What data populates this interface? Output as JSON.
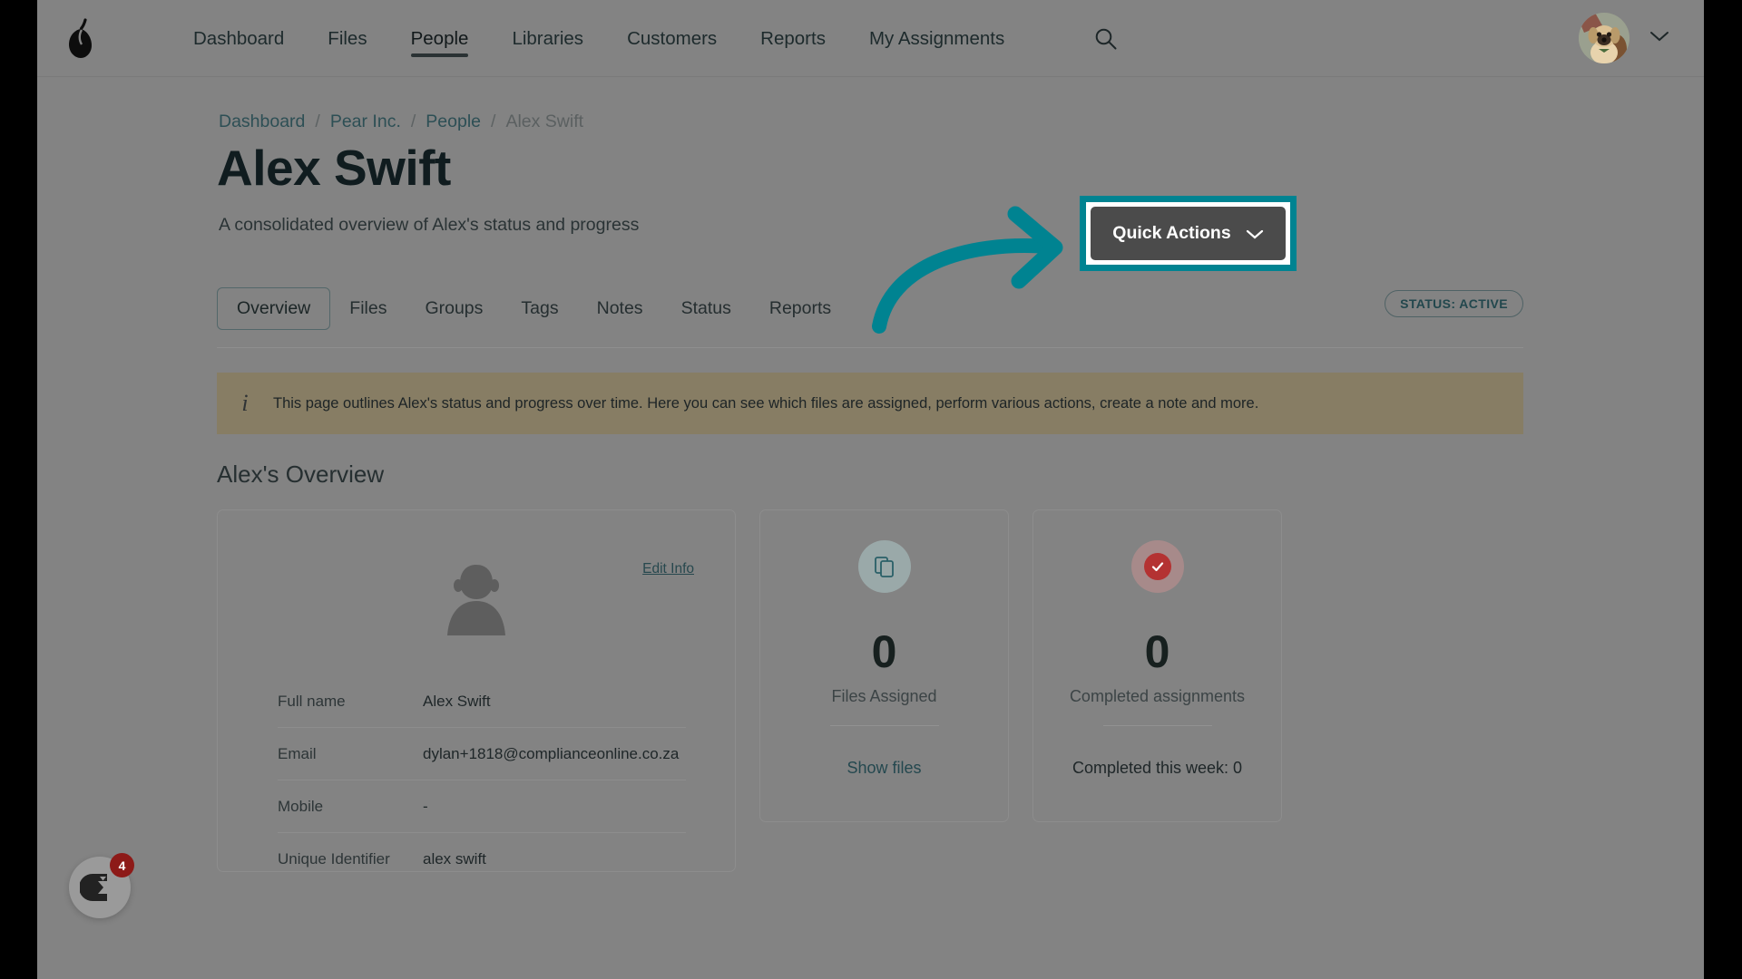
{
  "nav": {
    "brand_icon": "pear-logo-icon",
    "links": [
      {
        "label": "Dashboard",
        "active": false
      },
      {
        "label": "Files",
        "active": false
      },
      {
        "label": "People",
        "active": true
      },
      {
        "label": "Libraries",
        "active": false
      },
      {
        "label": "Customers",
        "active": false
      },
      {
        "label": "Reports",
        "active": false
      },
      {
        "label": "My Assignments",
        "active": false
      }
    ],
    "search_icon": "search-icon",
    "avatar_alt": "user-avatar-dog-photo",
    "chevron_icon": "chevron-down-icon"
  },
  "breadcrumb": {
    "items": [
      {
        "label": "Dashboard",
        "current": false
      },
      {
        "label": "Pear Inc.",
        "current": false
      },
      {
        "label": "People",
        "current": false
      },
      {
        "label": "Alex Swift",
        "current": true
      }
    ],
    "separator": "/"
  },
  "header": {
    "title": "Alex Swift",
    "subtitle": "A consolidated overview of Alex's status and progress",
    "quick_actions_label": "Quick Actions",
    "quick_actions_chevron": "chevron-down-icon"
  },
  "annotation": {
    "arrow_color": "#008391",
    "highlight_border_color": "#008391",
    "highlight_inner_color": "#ffffff"
  },
  "tabs": {
    "items": [
      {
        "label": "Overview",
        "active": true
      },
      {
        "label": "Files",
        "active": false
      },
      {
        "label": "Groups",
        "active": false
      },
      {
        "label": "Tags",
        "active": false
      },
      {
        "label": "Notes",
        "active": false
      },
      {
        "label": "Status",
        "active": false
      },
      {
        "label": "Reports",
        "active": false
      }
    ],
    "status_badge": "STATUS: ACTIVE"
  },
  "info_banner": {
    "icon": "info-icon",
    "icon_glyph": "i",
    "text": "This page outlines Alex's status and progress over time. Here you can see which files are assigned, perform various actions, create a note and more.",
    "background": "#877d64"
  },
  "overview": {
    "heading": "Alex's Overview"
  },
  "profile_card": {
    "edit_link": "Edit Info",
    "avatar_icon": "person-placeholder-avatar",
    "fields": [
      {
        "label": "Full name",
        "value": "Alex Swift"
      },
      {
        "label": "Email",
        "value": "dylan+1818@complianceonline.co.za"
      },
      {
        "label": "Mobile",
        "value": "-"
      },
      {
        "label": "Unique Identifier",
        "value": "alex swift"
      }
    ]
  },
  "stat_cards": [
    {
      "icon": "copy-files-icon",
      "icon_bg": "#9aa9a9",
      "number": "0",
      "label": "Files Assigned",
      "footer": "Show files",
      "footer_is_link": true
    },
    {
      "icon": "check-circle-icon",
      "icon_bg": "#a78a8a",
      "icon_color": "#b43232",
      "number": "0",
      "label": "Completed assignments",
      "footer": "Completed this week:  0",
      "footer_is_link": false
    }
  ],
  "chat_widget": {
    "icon": "chat-widget-icon",
    "badge_count": "4"
  }
}
